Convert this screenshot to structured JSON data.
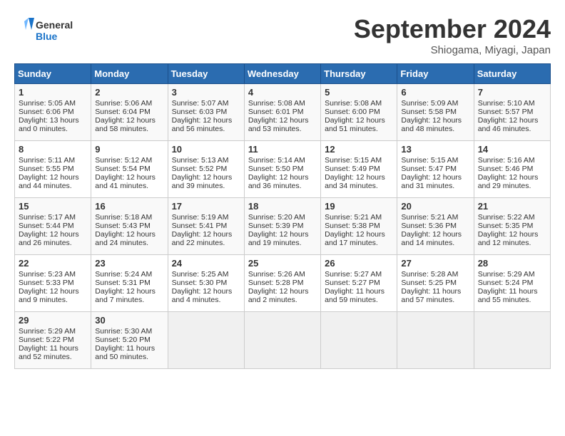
{
  "header": {
    "logo_line1": "General",
    "logo_line2": "Blue",
    "month": "September 2024",
    "location": "Shiogama, Miyagi, Japan"
  },
  "days_of_week": [
    "Sunday",
    "Monday",
    "Tuesday",
    "Wednesday",
    "Thursday",
    "Friday",
    "Saturday"
  ],
  "weeks": [
    [
      {
        "day": "1",
        "info": "Sunrise: 5:05 AM\nSunset: 6:06 PM\nDaylight: 13 hours\nand 0 minutes."
      },
      {
        "day": "2",
        "info": "Sunrise: 5:06 AM\nSunset: 6:04 PM\nDaylight: 12 hours\nand 58 minutes."
      },
      {
        "day": "3",
        "info": "Sunrise: 5:07 AM\nSunset: 6:03 PM\nDaylight: 12 hours\nand 56 minutes."
      },
      {
        "day": "4",
        "info": "Sunrise: 5:08 AM\nSunset: 6:01 PM\nDaylight: 12 hours\nand 53 minutes."
      },
      {
        "day": "5",
        "info": "Sunrise: 5:08 AM\nSunset: 6:00 PM\nDaylight: 12 hours\nand 51 minutes."
      },
      {
        "day": "6",
        "info": "Sunrise: 5:09 AM\nSunset: 5:58 PM\nDaylight: 12 hours\nand 48 minutes."
      },
      {
        "day": "7",
        "info": "Sunrise: 5:10 AM\nSunset: 5:57 PM\nDaylight: 12 hours\nand 46 minutes."
      }
    ],
    [
      {
        "day": "8",
        "info": "Sunrise: 5:11 AM\nSunset: 5:55 PM\nDaylight: 12 hours\nand 44 minutes."
      },
      {
        "day": "9",
        "info": "Sunrise: 5:12 AM\nSunset: 5:54 PM\nDaylight: 12 hours\nand 41 minutes."
      },
      {
        "day": "10",
        "info": "Sunrise: 5:13 AM\nSunset: 5:52 PM\nDaylight: 12 hours\nand 39 minutes."
      },
      {
        "day": "11",
        "info": "Sunrise: 5:14 AM\nSunset: 5:50 PM\nDaylight: 12 hours\nand 36 minutes."
      },
      {
        "day": "12",
        "info": "Sunrise: 5:15 AM\nSunset: 5:49 PM\nDaylight: 12 hours\nand 34 minutes."
      },
      {
        "day": "13",
        "info": "Sunrise: 5:15 AM\nSunset: 5:47 PM\nDaylight: 12 hours\nand 31 minutes."
      },
      {
        "day": "14",
        "info": "Sunrise: 5:16 AM\nSunset: 5:46 PM\nDaylight: 12 hours\nand 29 minutes."
      }
    ],
    [
      {
        "day": "15",
        "info": "Sunrise: 5:17 AM\nSunset: 5:44 PM\nDaylight: 12 hours\nand 26 minutes."
      },
      {
        "day": "16",
        "info": "Sunrise: 5:18 AM\nSunset: 5:43 PM\nDaylight: 12 hours\nand 24 minutes."
      },
      {
        "day": "17",
        "info": "Sunrise: 5:19 AM\nSunset: 5:41 PM\nDaylight: 12 hours\nand 22 minutes."
      },
      {
        "day": "18",
        "info": "Sunrise: 5:20 AM\nSunset: 5:39 PM\nDaylight: 12 hours\nand 19 minutes."
      },
      {
        "day": "19",
        "info": "Sunrise: 5:21 AM\nSunset: 5:38 PM\nDaylight: 12 hours\nand 17 minutes."
      },
      {
        "day": "20",
        "info": "Sunrise: 5:21 AM\nSunset: 5:36 PM\nDaylight: 12 hours\nand 14 minutes."
      },
      {
        "day": "21",
        "info": "Sunrise: 5:22 AM\nSunset: 5:35 PM\nDaylight: 12 hours\nand 12 minutes."
      }
    ],
    [
      {
        "day": "22",
        "info": "Sunrise: 5:23 AM\nSunset: 5:33 PM\nDaylight: 12 hours\nand 9 minutes."
      },
      {
        "day": "23",
        "info": "Sunrise: 5:24 AM\nSunset: 5:31 PM\nDaylight: 12 hours\nand 7 minutes."
      },
      {
        "day": "24",
        "info": "Sunrise: 5:25 AM\nSunset: 5:30 PM\nDaylight: 12 hours\nand 4 minutes."
      },
      {
        "day": "25",
        "info": "Sunrise: 5:26 AM\nSunset: 5:28 PM\nDaylight: 12 hours\nand 2 minutes."
      },
      {
        "day": "26",
        "info": "Sunrise: 5:27 AM\nSunset: 5:27 PM\nDaylight: 11 hours\nand 59 minutes."
      },
      {
        "day": "27",
        "info": "Sunrise: 5:28 AM\nSunset: 5:25 PM\nDaylight: 11 hours\nand 57 minutes."
      },
      {
        "day": "28",
        "info": "Sunrise: 5:29 AM\nSunset: 5:24 PM\nDaylight: 11 hours\nand 55 minutes."
      }
    ],
    [
      {
        "day": "29",
        "info": "Sunrise: 5:29 AM\nSunset: 5:22 PM\nDaylight: 11 hours\nand 52 minutes."
      },
      {
        "day": "30",
        "info": "Sunrise: 5:30 AM\nSunset: 5:20 PM\nDaylight: 11 hours\nand 50 minutes."
      },
      {
        "day": "",
        "info": ""
      },
      {
        "day": "",
        "info": ""
      },
      {
        "day": "",
        "info": ""
      },
      {
        "day": "",
        "info": ""
      },
      {
        "day": "",
        "info": ""
      }
    ]
  ]
}
